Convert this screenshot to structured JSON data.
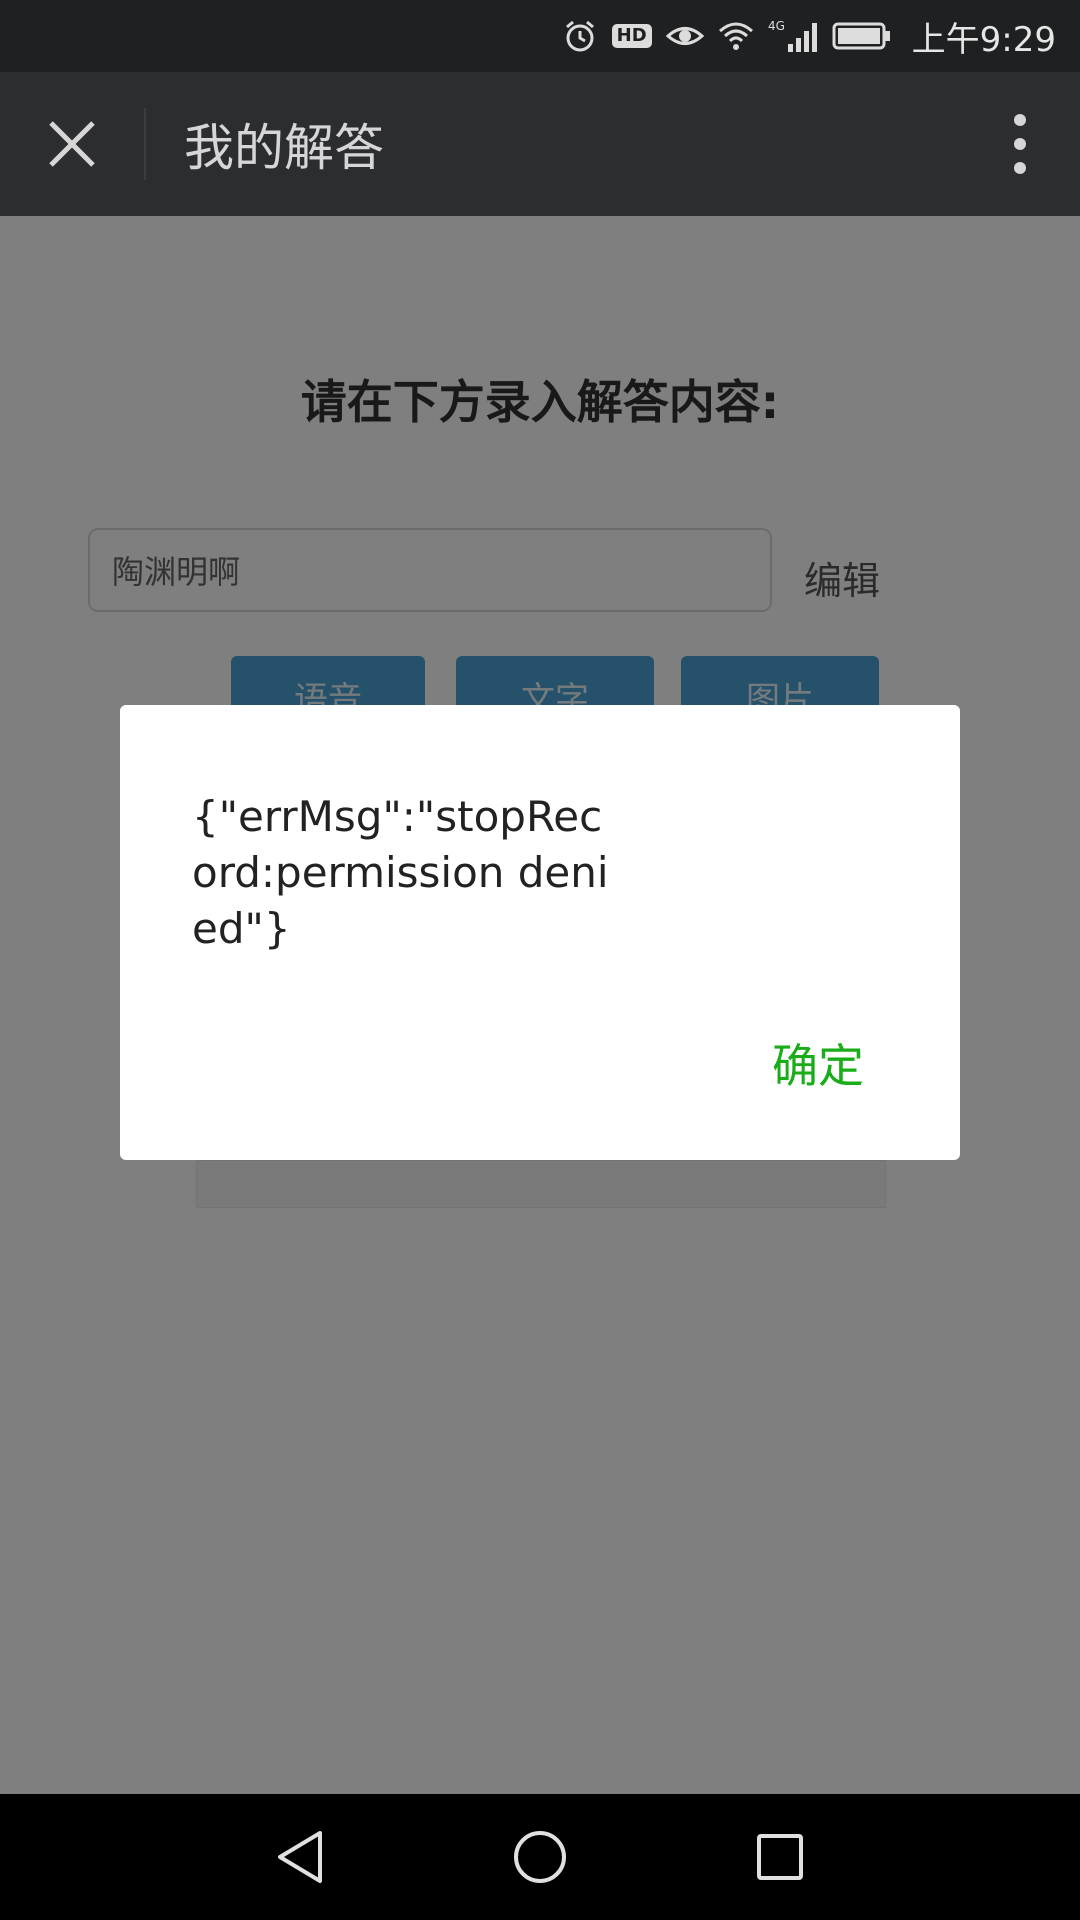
{
  "status_bar": {
    "time": "上午9:29",
    "hd_label": "HD",
    "network_label": "4G",
    "icons": [
      "alarm-icon",
      "hd-icon",
      "eye-icon",
      "wifi-icon",
      "signal-4g-icon",
      "battery-icon"
    ]
  },
  "title_bar": {
    "title": "我的解答",
    "close_icon": "close-icon",
    "more_icon": "more-vertical-icon"
  },
  "page": {
    "heading": "请在下方录入解答内容:",
    "input_value": "陶渊明啊",
    "edit_label": "编辑",
    "buttons": [
      {
        "label": "语音"
      },
      {
        "label": "文字"
      },
      {
        "label": "图片"
      }
    ]
  },
  "dialog": {
    "message": "{\"errMsg\":\"stopRecord:permission denied\"}",
    "confirm_label": "确定",
    "confirm_color": "#1aad19"
  },
  "nav_bar": {
    "icons": [
      "back-icon",
      "home-icon",
      "recent-apps-icon"
    ]
  },
  "colors": {
    "status_bar_bg": "#1f2022",
    "title_bar_bg": "#2c2d30",
    "button_blue": "#4aa3d6"
  }
}
